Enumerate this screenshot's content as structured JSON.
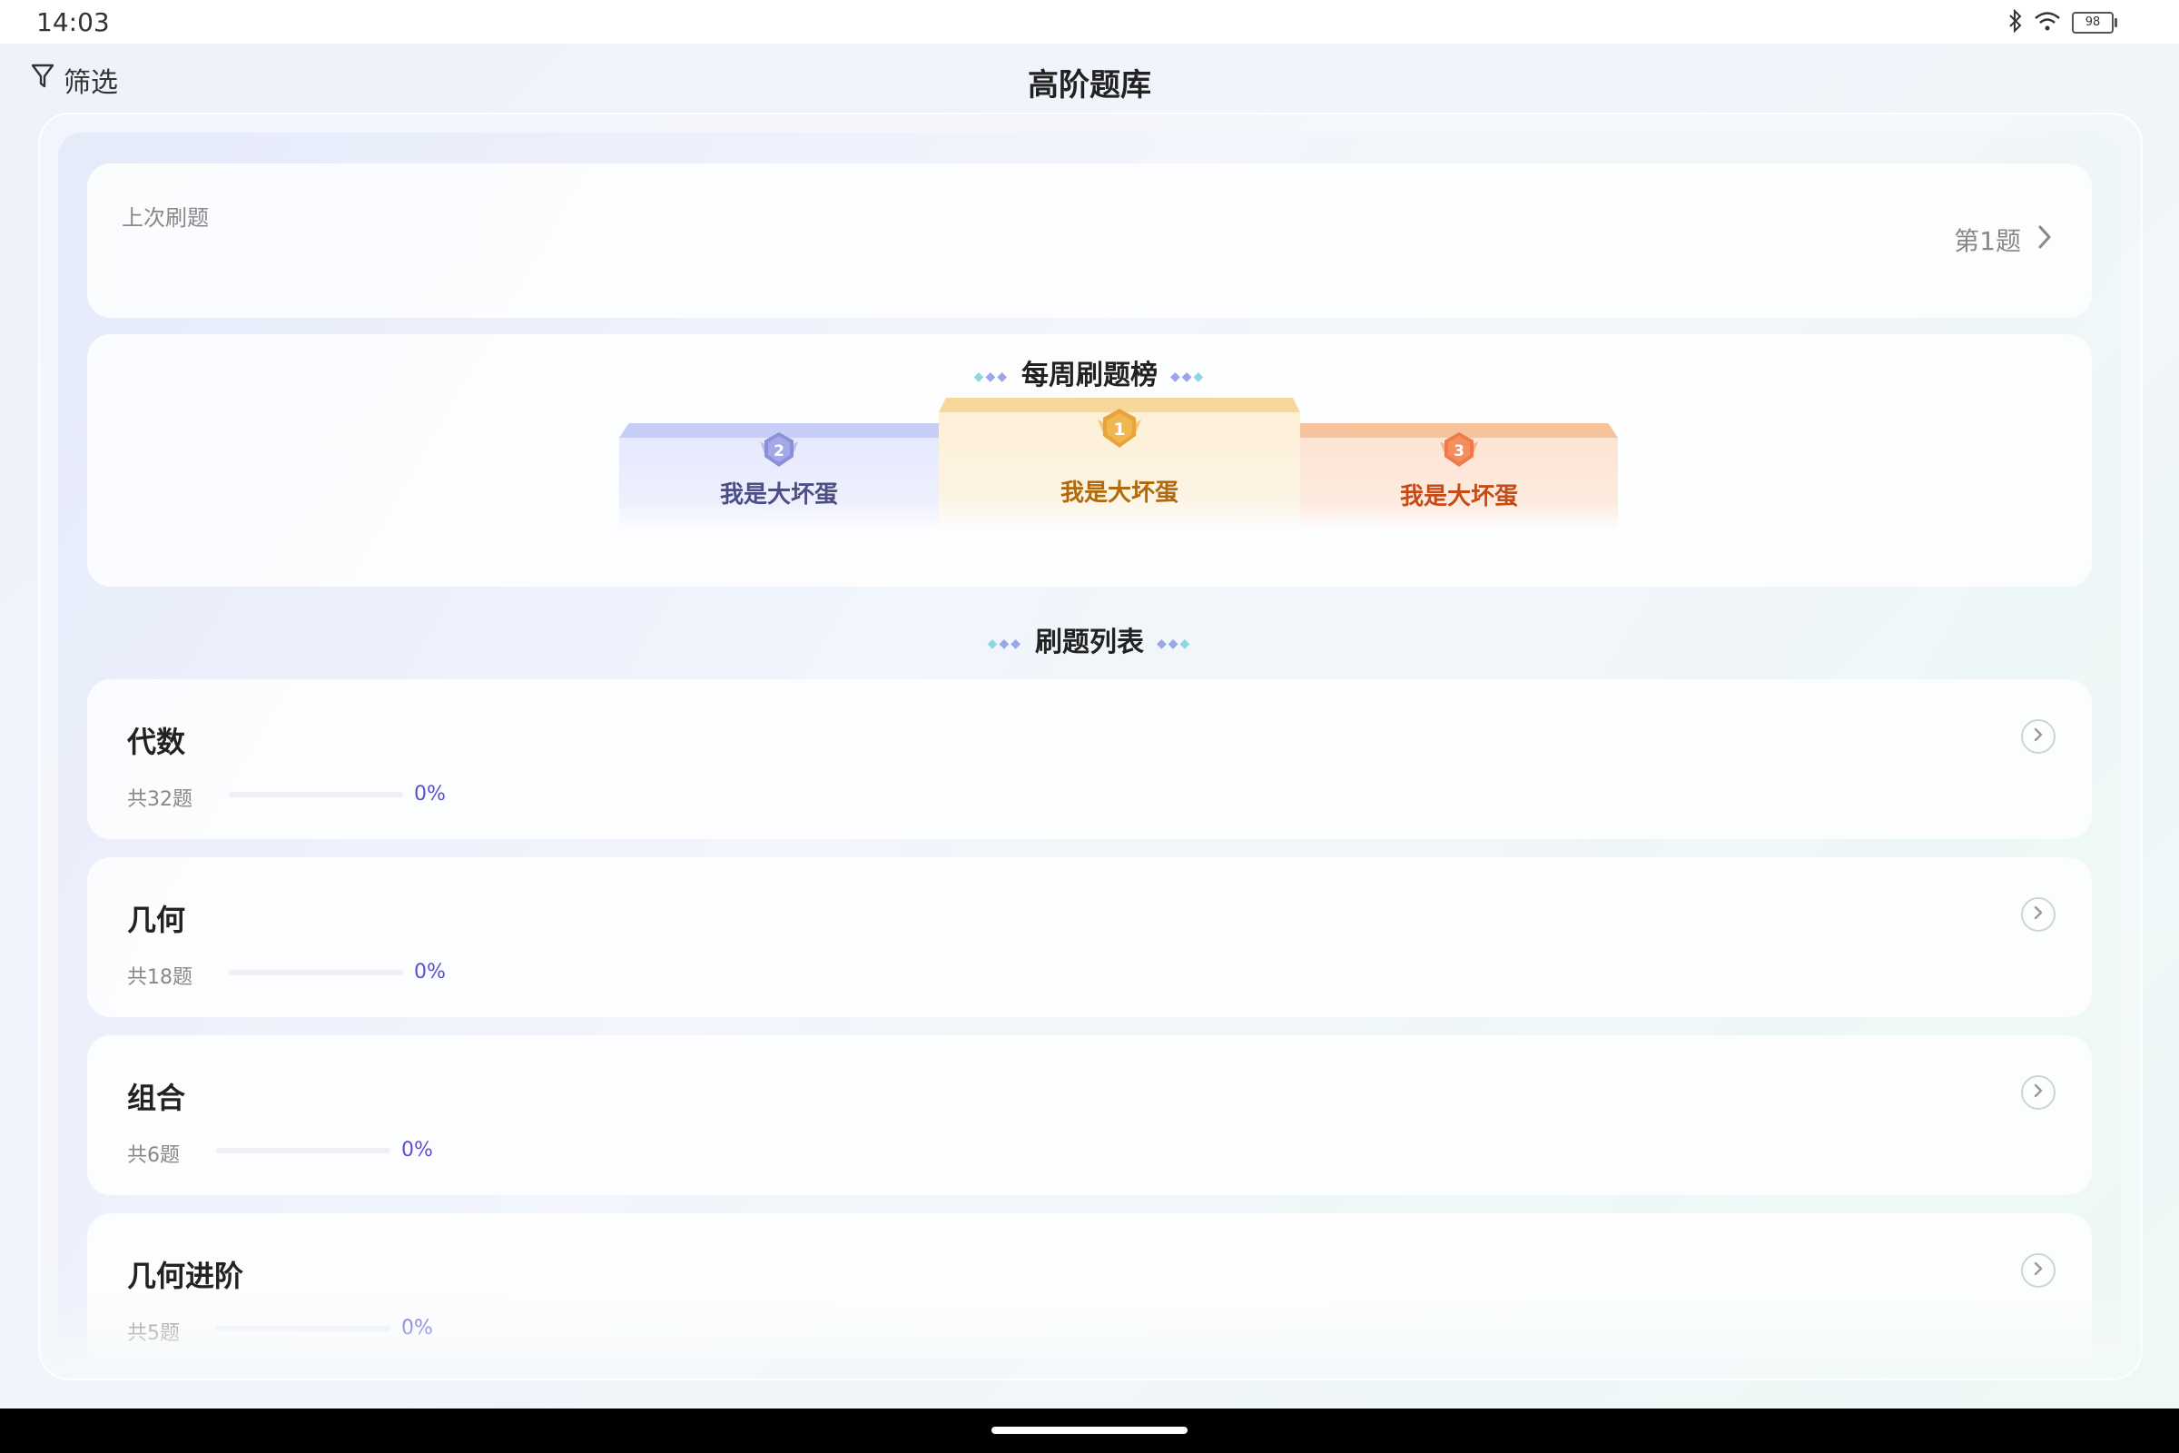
{
  "status_bar": {
    "time": "14:03",
    "battery": "98"
  },
  "header": {
    "filter_label": "筛选",
    "title": "高阶题库"
  },
  "last_practice": {
    "label": "上次刷题",
    "progress": "第1题"
  },
  "ranking": {
    "title": "每周刷题榜",
    "podium": [
      {
        "rank": "2",
        "name": "我是大坏蛋",
        "color": "#8a8fd8"
      },
      {
        "rank": "1",
        "name": "我是大坏蛋",
        "color": "#e8a33a"
      },
      {
        "rank": "3",
        "name": "我是大坏蛋",
        "color": "#ef7a47"
      }
    ]
  },
  "practice_list": {
    "title": "刷题列表",
    "items": [
      {
        "name": "代数",
        "count": "共32题",
        "progress_text": "0%",
        "progress": 0
      },
      {
        "name": "几何",
        "count": "共18题",
        "progress_text": "0%",
        "progress": 0
      },
      {
        "name": "组合",
        "count": "共6题",
        "progress_text": "0%",
        "progress": 0
      },
      {
        "name": "几何进阶",
        "count": "共5题",
        "progress_text": "0%",
        "progress": 0
      }
    ]
  },
  "colors": {
    "accent": "#5b4fd0",
    "gold": "#e8a33a",
    "silver": "#8a8fd8",
    "bronze": "#ef7a47"
  }
}
